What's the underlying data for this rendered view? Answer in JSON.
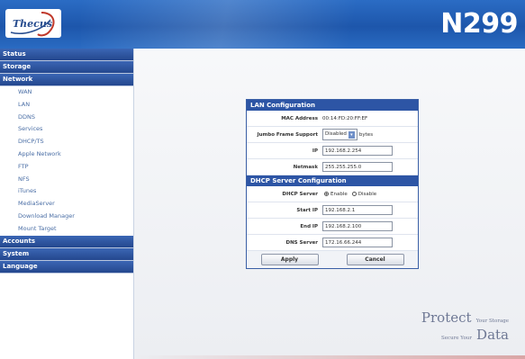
{
  "header": {
    "logo_text": "Thecus",
    "model": "N299"
  },
  "sidebar": {
    "categories": {
      "status": "Status",
      "storage": "Storage",
      "network": "Network",
      "accounts": "Accounts",
      "system": "System",
      "language": "Language"
    },
    "network_items": [
      "WAN",
      "LAN",
      "DDNS",
      "Services",
      "DHCP/TS",
      "Apple Network",
      "FTP",
      "NFS",
      "iTunes",
      "MediaServer",
      "Download Manager",
      "Mount Target"
    ]
  },
  "lan": {
    "title": "LAN Configuration",
    "mac_label": "MAC Address",
    "mac_value": "00:14:FD:20:FF:EF",
    "jumbo_label": "Jumbo Frame Support",
    "jumbo_value": "Disabled",
    "jumbo_unit": "bytes",
    "ip_label": "IP",
    "ip_value": "192.168.2.254",
    "netmask_label": "Netmask",
    "netmask_value": "255.255.255.0"
  },
  "dhcp": {
    "title": "DHCP Server Configuration",
    "server_label": "DHCP Server",
    "enable_label": "Enable",
    "disable_label": "Disable",
    "selected": "enable",
    "start_label": "Start IP",
    "start_value": "192.168.2.1",
    "end_label": "End IP",
    "end_value": "192.168.2.100",
    "dns_label": "DNS Server",
    "dns_value": "172.16.66.244"
  },
  "actions": {
    "apply": "Apply",
    "cancel": "Cancel"
  },
  "tagline": {
    "protect": "Protect",
    "your_storage": "Your Storage",
    "secure_your": "Secure Your",
    "data": "Data"
  }
}
